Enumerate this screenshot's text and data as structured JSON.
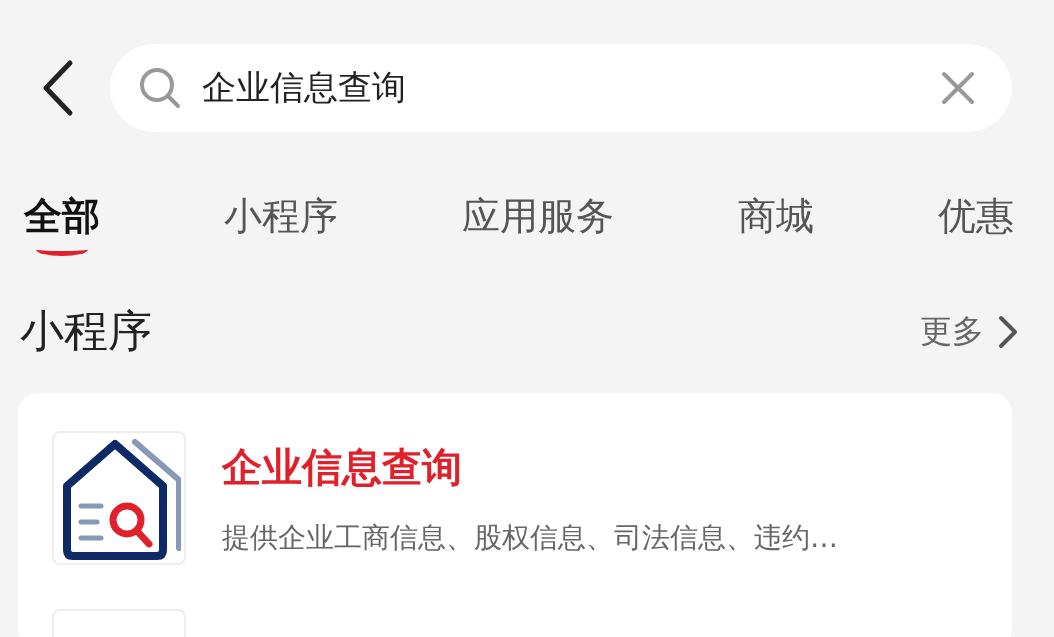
{
  "search": {
    "value": "企业信息查询"
  },
  "tabs": [
    {
      "label": "全部",
      "selected": true
    },
    {
      "label": "小程序",
      "selected": false
    },
    {
      "label": "应用服务",
      "selected": false
    },
    {
      "label": "商城",
      "selected": false
    },
    {
      "label": "优惠",
      "selected": false
    }
  ],
  "section": {
    "title": "小程序",
    "more": "更多"
  },
  "results": [
    {
      "title": "企业信息查询",
      "description": "提供企业工商信息、股权信息、司法信息、违约…"
    }
  ]
}
